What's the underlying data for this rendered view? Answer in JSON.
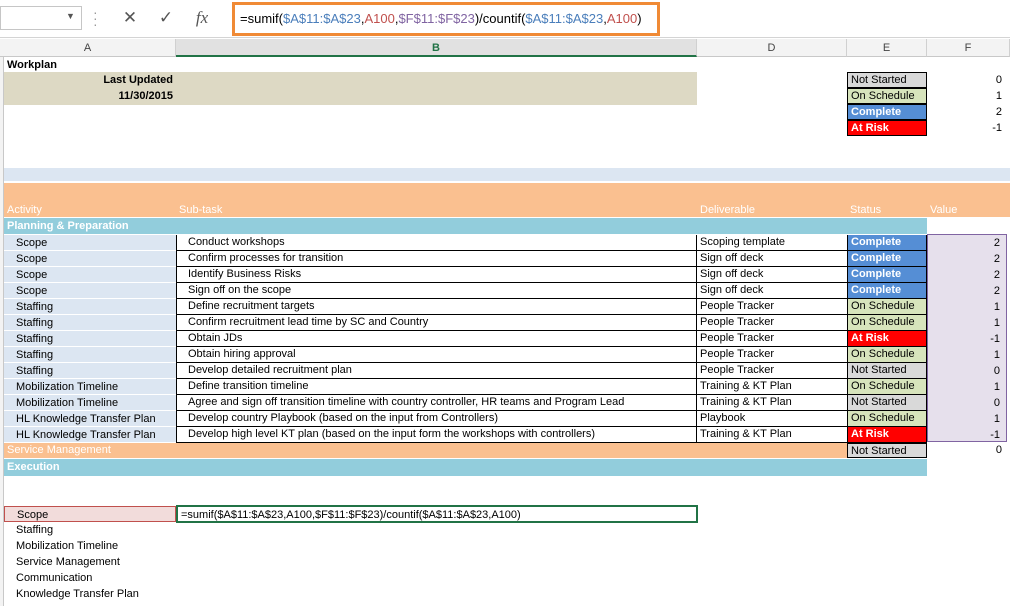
{
  "formula_bar": {
    "cancel_icon": "✕",
    "enter_icon": "✓",
    "fx_label": "fx",
    "formula_parts": [
      {
        "t": "=sumif(",
        "c": "dark"
      },
      {
        "t": "$A$11:$A$23",
        "c": "blue"
      },
      {
        "t": ",",
        "c": "dark"
      },
      {
        "t": "A100",
        "c": "red"
      },
      {
        "t": ",",
        "c": "dark"
      },
      {
        "t": "$F$11:$F$23",
        "c": "purp"
      },
      {
        "t": ")/countif(",
        "c": "dark"
      },
      {
        "t": "$A$11:$A$23",
        "c": "blue"
      },
      {
        "t": ",",
        "c": "dark"
      },
      {
        "t": "A100",
        "c": "red"
      },
      {
        "t": ")",
        "c": "dark"
      }
    ]
  },
  "columns": [
    "A",
    "B",
    "D",
    "E",
    "F"
  ],
  "sheet": {
    "title": "Workplan",
    "last_updated_label": "Last Updated",
    "last_updated_date": "11/30/2015",
    "legend": [
      {
        "label": "Not Started",
        "value": "0",
        "status": "ns"
      },
      {
        "label": "On Schedule",
        "value": "1",
        "status": "os"
      },
      {
        "label": "Complete",
        "value": "2",
        "status": "cp"
      },
      {
        "label": "At Risk",
        "value": "-1",
        "status": "ar"
      }
    ],
    "headers": {
      "activity": "Activity",
      "subtask": "Sub-task",
      "deliverable": "Deliverable",
      "status": "Status",
      "value": "Value"
    },
    "section_planning": "Planning & Preparation",
    "rows": [
      {
        "activity": "Scope",
        "subtask": "Conduct workshops",
        "deliverable": "Scoping template",
        "status": "Complete",
        "st": "cp",
        "value": "2"
      },
      {
        "activity": "Scope",
        "subtask": "Confirm processes  for transition",
        "deliverable": "Sign off deck",
        "status": "Complete",
        "st": "cp",
        "value": "2"
      },
      {
        "activity": "Scope",
        "subtask": "Identify Business Risks",
        "deliverable": "Sign off deck",
        "status": "Complete",
        "st": "cp",
        "value": "2"
      },
      {
        "activity": "Scope",
        "subtask": "Sign off on the scope",
        "deliverable": "Sign off deck",
        "status": "Complete",
        "st": "cp",
        "value": "2"
      },
      {
        "activity": "Staffing",
        "subtask": "Define recruitment targets",
        "deliverable": "People Tracker",
        "status": "On Schedule",
        "st": "os",
        "value": "1"
      },
      {
        "activity": "Staffing",
        "subtask": "Confirm recruitment lead time by SC and Country",
        "deliverable": "People Tracker",
        "status": "On Schedule",
        "st": "os",
        "value": "1"
      },
      {
        "activity": "Staffing",
        "subtask": "Obtain JDs",
        "deliverable": "People Tracker",
        "status": "At Risk",
        "st": "ar",
        "value": "-1"
      },
      {
        "activity": "Staffing",
        "subtask": "Obtain hiring approval",
        "deliverable": "People Tracker",
        "status": "On Schedule",
        "st": "os",
        "value": "1"
      },
      {
        "activity": "Staffing",
        "subtask": "Develop detailed recruitment plan",
        "deliverable": "People Tracker",
        "status": "Not Started",
        "st": "ns",
        "value": "0"
      },
      {
        "activity": "Mobilization Timeline",
        "subtask": "Define transition timeline",
        "deliverable": "Training & KT Plan",
        "status": "On Schedule",
        "st": "os",
        "value": "1"
      },
      {
        "activity": "Mobilization Timeline",
        "subtask": "Agree and sign off transition timeline with country controller, HR teams and Program Lead",
        "deliverable": "Training & KT Plan",
        "status": "Not Started",
        "st": "ns",
        "value": "0"
      },
      {
        "activity": "HL Knowledge Transfer Plan",
        "subtask": "Develop country Playbook (based on the input from Controllers)",
        "deliverable": "Playbook",
        "status": "On Schedule",
        "st": "os",
        "value": "1"
      },
      {
        "activity": "HL Knowledge Transfer Plan",
        "subtask": "Develop high level KT plan (based on the input form the workshops with controllers)",
        "deliverable": "Training & KT Plan",
        "status": "At Risk",
        "st": "ar",
        "value": "-1"
      }
    ],
    "service_mgmt": {
      "label": "Service Management",
      "status": "Not Started",
      "value": "0"
    },
    "section_execution": "Execution",
    "summary_list": [
      "Scope",
      "Staffing",
      "Mobilization Timeline",
      "Service Management",
      "Communication",
      "Knowledge Transfer Plan"
    ],
    "edit_formula": "=sumif($A$11:$A$23,A100,$F$11:$F$23)/countif($A$11:$A$23,A100)"
  }
}
